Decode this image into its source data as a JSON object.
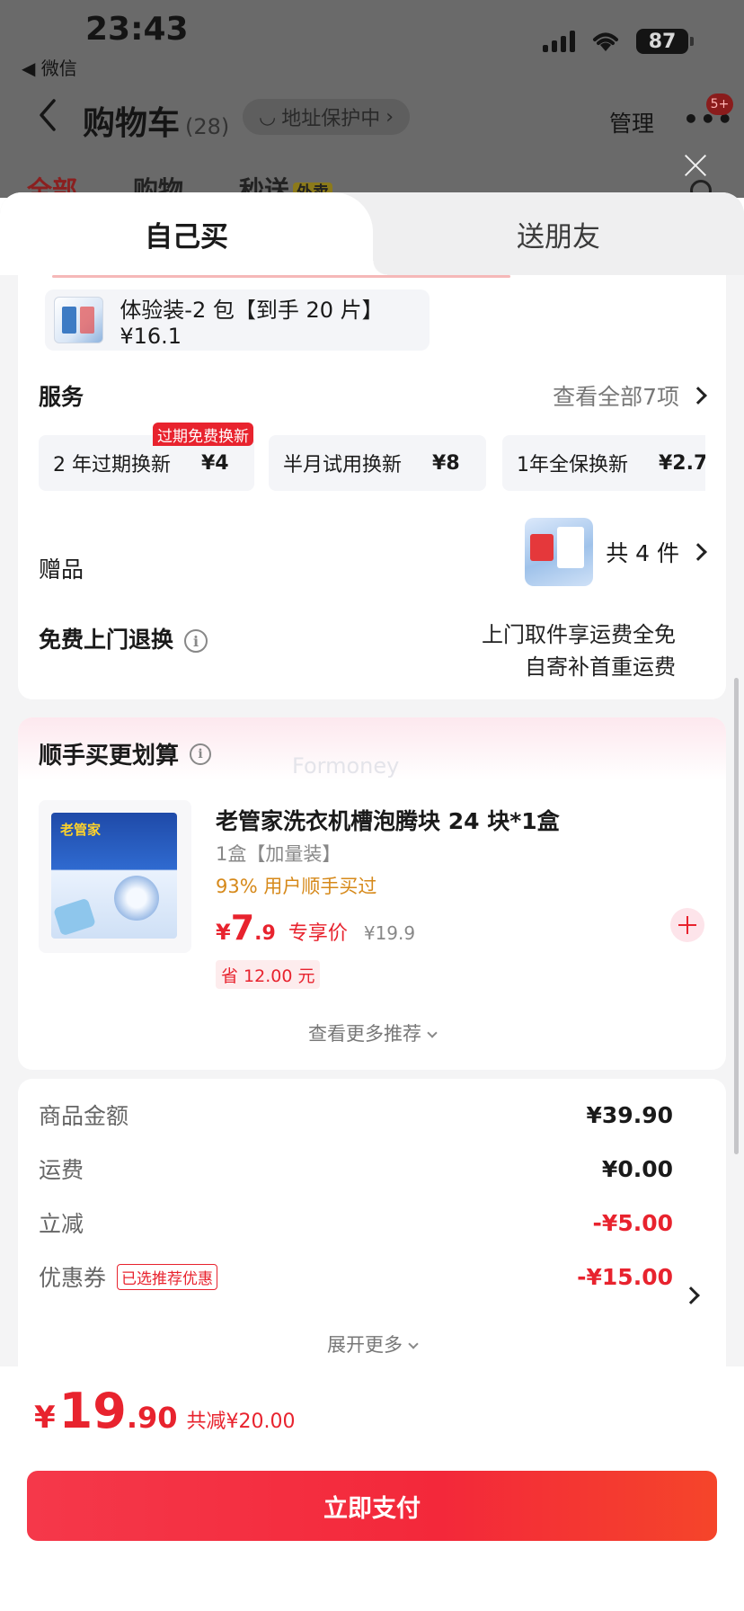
{
  "status_bar": {
    "time": "23:43",
    "back_app": "◀ 微信",
    "battery": "87"
  },
  "nav": {
    "title": "购物车",
    "count": "(28)",
    "address_protect": "地址保护中",
    "manage": "管理",
    "more": "•••",
    "badge": "5+"
  },
  "bg_tabs": [
    {
      "label": "全部"
    },
    {
      "label": "购物"
    },
    {
      "label": "秒送",
      "tag": "外卖"
    }
  ],
  "sheet": {
    "tabs": [
      {
        "label": "自己买"
      },
      {
        "label": "送朋友"
      }
    ],
    "variant": {
      "text": "体验装-2 包【到手 20 片】¥16.1"
    },
    "service": {
      "title": "服务",
      "view_all": "查看全部7项",
      "items": [
        {
          "name": "2 年过期换新",
          "price": "¥4",
          "badge": "过期免费换新"
        },
        {
          "name": "半月试用换新",
          "price": "¥8"
        },
        {
          "name": "1年全保换新",
          "price": "¥2.7"
        }
      ]
    },
    "gift": {
      "title": "赠品",
      "count": "共 4 件"
    },
    "return": {
      "title": "免费上门退换",
      "line1": "上门取件享运费全免",
      "line2": "自寄补首重运费"
    },
    "recommend": {
      "title": "顺手买更划算",
      "watermark": "Formoney",
      "product": {
        "name": "老管家洗衣机槽泡腾块 24 块*1盒",
        "spec": "1盒【加量装】",
        "buy_rate": "93% 用户顺手买过",
        "price_yen": "¥",
        "price_int": "7",
        "price_dec": ".9",
        "price_tag": "专享价",
        "orig_price": "¥19.9",
        "save": "省 12.00 元",
        "image_brand": "老管家"
      },
      "more": "查看更多推荐"
    },
    "summary": {
      "rows": [
        {
          "label": "商品金额",
          "value": "¥39.90"
        },
        {
          "label": "运费",
          "value": "¥0.00"
        },
        {
          "label": "立减",
          "value": "-¥5.00"
        },
        {
          "label": "优惠券",
          "tag": "已选推荐优惠",
          "value": "-¥15.00"
        }
      ],
      "expand": "展开更多"
    }
  },
  "footer": {
    "yen": "¥",
    "total_int": "19",
    "total_dec": ".90",
    "saved": "共减¥20.00",
    "pay": "立即支付"
  },
  "colors": {
    "accent_red": "#e8232e",
    "warn_orange": "#d6891a"
  }
}
